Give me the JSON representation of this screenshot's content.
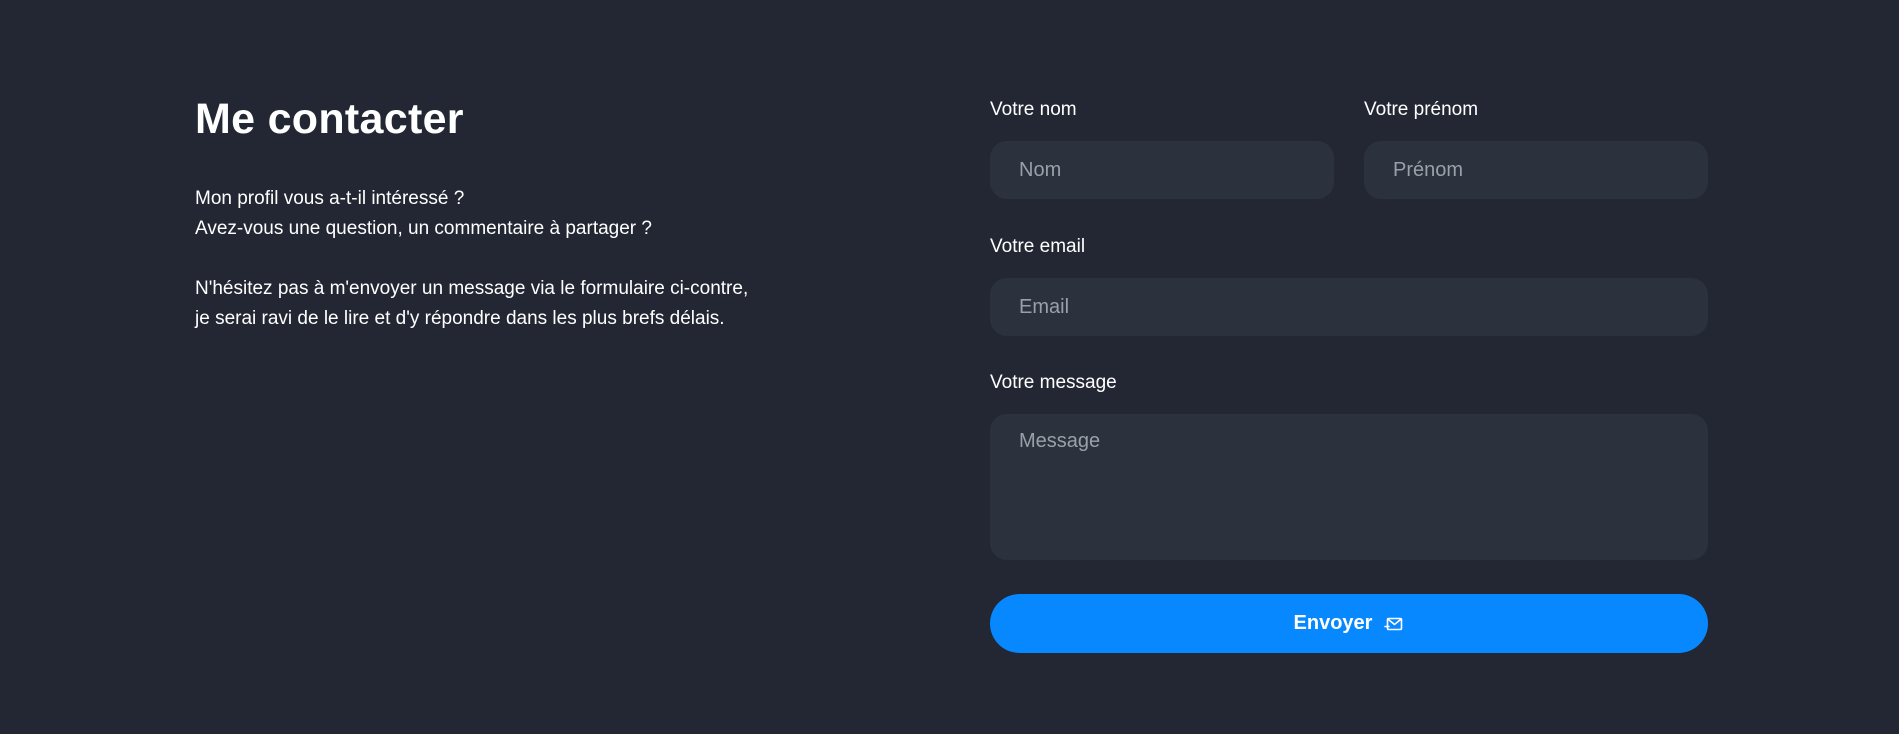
{
  "contact": {
    "title": "Me contacter",
    "intro_line1": "Mon profil vous a-t-il intéressé ?",
    "intro_line2": "Avez-vous une question, un commentaire à partager ?",
    "intro_line3": "N'hésitez pas à m'envoyer un message via le formulaire ci-contre,",
    "intro_line4": "je serai ravi de le lire et d'y répondre dans les plus brefs délais."
  },
  "form": {
    "nom_label": "Votre nom",
    "nom_placeholder": "Nom",
    "nom_value": "",
    "prenom_label": "Votre prénom",
    "prenom_placeholder": "Prénom",
    "prenom_value": "",
    "email_label": "Votre email",
    "email_placeholder": "Email",
    "email_value": "",
    "message_label": "Votre message",
    "message_placeholder": "Message",
    "message_value": "",
    "submit_label": "Envoyer",
    "submit_icon": "send-mail-icon"
  },
  "colors": {
    "background": "#222733",
    "field_background": "#2c323d",
    "placeholder": "#9aa0a8",
    "accent": "#0788ff",
    "text": "#ffffff"
  }
}
